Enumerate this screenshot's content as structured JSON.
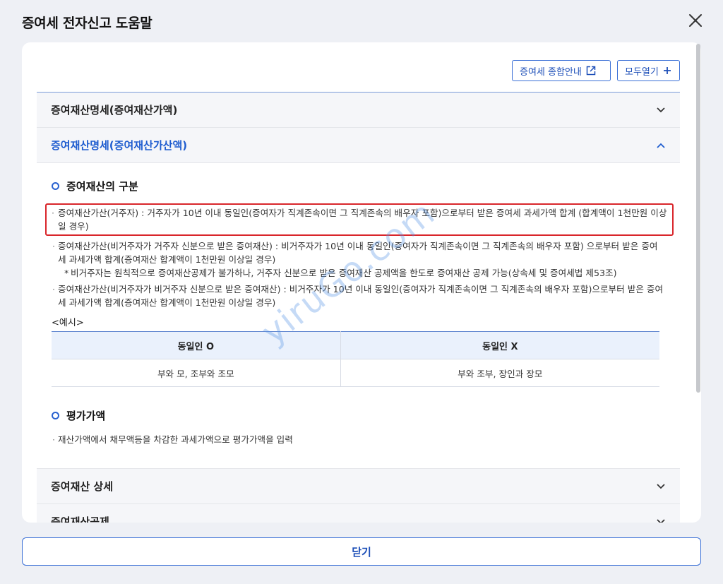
{
  "dialog": {
    "title": "증여세 전자신고 도움말"
  },
  "top_buttons": {
    "guide_label": "증여세 종합안내",
    "expand_label": "모두열기"
  },
  "accordion": [
    {
      "label": "증여재산명세(증여재산가액)",
      "expanded": false
    },
    {
      "label": "증여재산명세(증여재산가산액)",
      "expanded": true
    },
    {
      "label": "증여재산 상세",
      "expanded": false
    },
    {
      "label": "증여재산공제",
      "expanded": false
    }
  ],
  "section1": {
    "title": "증여재산의 구분",
    "items": [
      {
        "text": "증여재산가산(거주자) : 거주자가 10년 이내 동일인(증여자가 직계존속이면 그 직계존속의 배우자 포함)으로부터 받은 증여세 과세가액 합계 (합계액이 1천만원 이상일 경우)"
      },
      {
        "text": "증여재산가산(비거주자가 거주자 신분으로 받은 증여재산) : 비거주자가 10년 이내 동일인(증여자가 직계존속이면 그 직계존속의 배우자 포함) 으로부터 받은 증여세 과세가액 합계(증여재산 합계액이 1천만원 이상일 경우)"
      },
      {
        "text": "증여재산가산(비거주자가 비거주자 신분으로 받은 증여재산) : 비거주자가 10년 이내 동일인(증여자가 직계존속이면 그 직계존속의 배우자 포함)으로부터 받은 증여세 과세가액 합계(증여재산 합계액이 1천만원 이상일 경우)"
      }
    ],
    "note": "비거주자는 원칙적으로 증여재산공제가 불가하나, 거주자 신분으로 받은 증여재산 공제액을 한도로 증여재산 공제 가능(상속세 및 증여세법 제53조)",
    "example_label": "<예시>",
    "table": {
      "headers": [
        "동일인 O",
        "동일인 X"
      ],
      "row": [
        "부와 모, 조부와 조모",
        "부와 조부, 장인과 장모"
      ]
    }
  },
  "section2": {
    "title": "평가가액",
    "item": "재산가액에서 채무액등을 차감한 과세가액으로 평가가액을 입력"
  },
  "watermark": "yiruGo.com",
  "footer": {
    "close_label": "닫기"
  }
}
